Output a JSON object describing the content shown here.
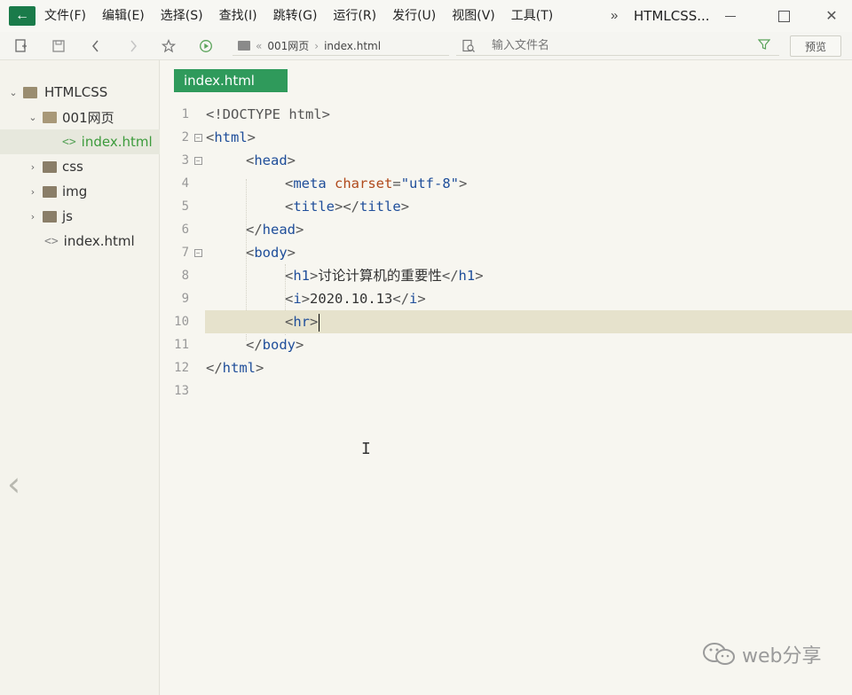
{
  "menubar": {
    "items": [
      "文件(F)",
      "编辑(E)",
      "选择(S)",
      "查找(I)",
      "跳转(G)",
      "运行(R)",
      "发行(U)",
      "视图(V)",
      "工具(T)"
    ],
    "title": "HTMLCSS..."
  },
  "toolbar": {
    "breadcrumb": [
      "001网页",
      "index.html"
    ],
    "file_search_placeholder": "输入文件名",
    "preview_label": "预览"
  },
  "sidebar": {
    "items": [
      {
        "label": "HTMLCSS",
        "type": "project",
        "expanded": true
      },
      {
        "label": "001网页",
        "type": "folder",
        "expanded": true
      },
      {
        "label": "index.html",
        "type": "file",
        "selected": true
      },
      {
        "label": "css",
        "type": "folder",
        "expanded": false
      },
      {
        "label": "img",
        "type": "folder",
        "expanded": false
      },
      {
        "label": "js",
        "type": "folder",
        "expanded": false
      },
      {
        "label": "index.html",
        "type": "file",
        "selected": false
      }
    ]
  },
  "editor": {
    "active_tab": "index.html",
    "current_line": 10,
    "lines": [
      {
        "n": "1",
        "text": "<!DOCTYPE html>"
      },
      {
        "n": "2",
        "text": "<html>"
      },
      {
        "n": "3",
        "text": "<head>"
      },
      {
        "n": "4",
        "text": "<meta charset=\"utf-8\">"
      },
      {
        "n": "5",
        "text": "<title></title>"
      },
      {
        "n": "6",
        "text": "</head>"
      },
      {
        "n": "7",
        "text": "<body>"
      },
      {
        "n": "8",
        "text": "<h1>讨论计算机的重要性</h1>"
      },
      {
        "n": "9",
        "text": "<i>2020.10.13</i>"
      },
      {
        "n": "10",
        "text": "<hr>"
      },
      {
        "n": "11",
        "text": "</body>"
      },
      {
        "n": "12",
        "text": "</html>"
      },
      {
        "n": "13",
        "text": ""
      }
    ]
  },
  "watermark": {
    "text": "web分享"
  }
}
